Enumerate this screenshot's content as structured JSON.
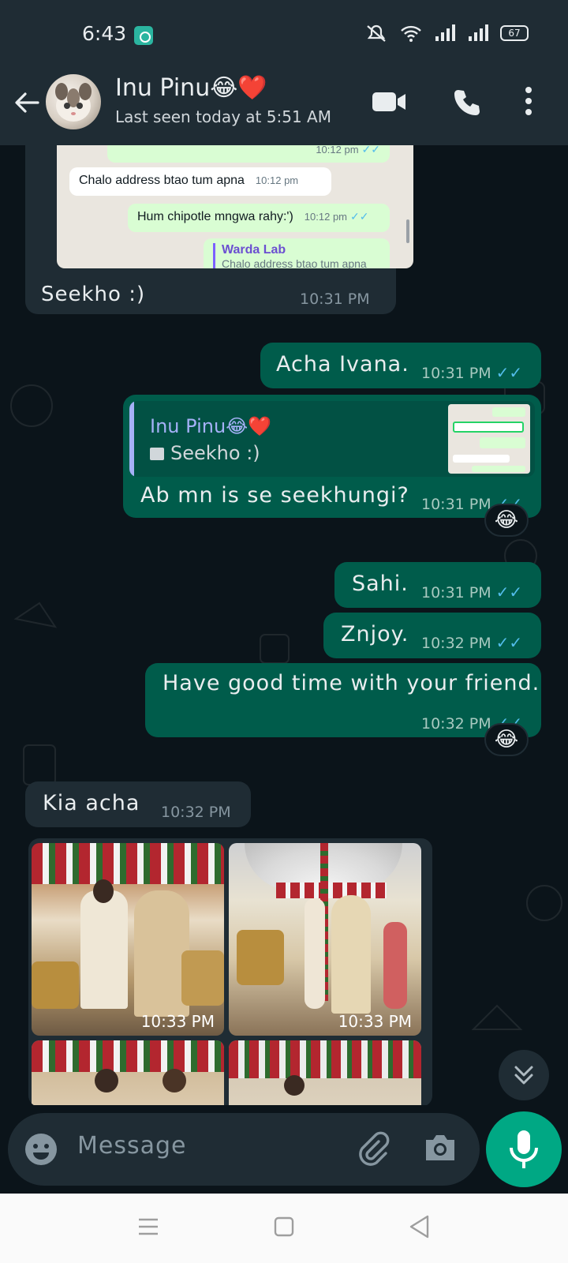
{
  "status_bar": {
    "time": "6:43",
    "battery": "67"
  },
  "header": {
    "contact_name": "Inu Pinu😂❤️",
    "last_seen": "Last seen today at 5:51 AM"
  },
  "screenshot_preview": {
    "messages": [
      {
        "text": "",
        "time": "10:12 pm",
        "direction": "out"
      },
      {
        "text": "Chalo address btao tum apna",
        "time": "10:12 pm",
        "direction": "in"
      },
      {
        "text": "Hum chipotle mngwa rahy:')",
        "time": "10:12 pm",
        "direction": "out"
      }
    ],
    "reply_name": "Warda Lab",
    "reply_text": "Chalo address btao tum apna"
  },
  "messages": [
    {
      "id": "m1",
      "direction": "in",
      "text": "Seekho :)",
      "time": "10:31 PM"
    },
    {
      "id": "m2",
      "direction": "out",
      "text": "Acha Ivana.",
      "time": "10:31 PM"
    },
    {
      "id": "m3",
      "direction": "out",
      "quote_name": "Inu Pinu😂❤️",
      "quote_text": "Seekho :)",
      "text": "Ab mn is se seekhungi?",
      "time": "10:31 PM",
      "reaction": "😂"
    },
    {
      "id": "m4",
      "direction": "out",
      "text": "Sahi.",
      "time": "10:31 PM"
    },
    {
      "id": "m5",
      "direction": "out",
      "text": "Znjoy.",
      "time": "10:32 PM"
    },
    {
      "id": "m6",
      "direction": "out",
      "text": "Have good time with your friend.",
      "time": "10:32 PM",
      "reaction": "😂"
    },
    {
      "id": "m7",
      "direction": "in",
      "text": "Kia acha",
      "time": "10:32 PM"
    }
  ],
  "photos": [
    {
      "time": "10:33 PM"
    },
    {
      "time": "10:33 PM"
    }
  ],
  "composer": {
    "placeholder": "Message"
  },
  "colors": {
    "background": "#0b141a",
    "header": "#1f2c34",
    "incoming_bubble": "#1f2c34",
    "outgoing_bubble": "#005c4b",
    "accent": "#00a884",
    "read_ticks": "#53bdeb"
  }
}
